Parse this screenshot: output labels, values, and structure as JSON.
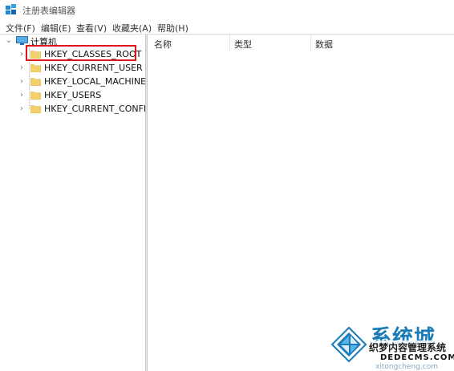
{
  "window": {
    "title": "注册表编辑器"
  },
  "menu": [
    {
      "label": "文件(F)"
    },
    {
      "label": "编辑(E)"
    },
    {
      "label": "查看(V)"
    },
    {
      "label": "收藏夹(A)"
    },
    {
      "label": "帮助(H)"
    }
  ],
  "tree": {
    "root": {
      "label": "计算机",
      "expanded": true
    },
    "items": [
      {
        "label": "HKEY_CLASSES_ROOT",
        "highlighted": true
      },
      {
        "label": "HKEY_CURRENT_USER"
      },
      {
        "label": "HKEY_LOCAL_MACHINE"
      },
      {
        "label": "HKEY_USERS"
      },
      {
        "label": "HKEY_CURRENT_CONFIG"
      }
    ]
  },
  "list": {
    "columns": [
      {
        "label": "名称"
      },
      {
        "label": "类型"
      },
      {
        "label": "数据"
      }
    ]
  },
  "watermark": {
    "main": "系统城",
    "sub": "织梦内容管理系统",
    "domain": "DEDECMS.COM",
    "faint": "xitongcheng.com"
  },
  "colors": {
    "accent": "#0078d7",
    "highlight_border": "#e0141c",
    "folder": "#f2d16b"
  },
  "icons": {
    "app": "registry-editor-icon",
    "root": "computer-icon",
    "folder": "folder-icon",
    "expand": "chevron-right-icon",
    "collapse": "chevron-down-icon"
  }
}
